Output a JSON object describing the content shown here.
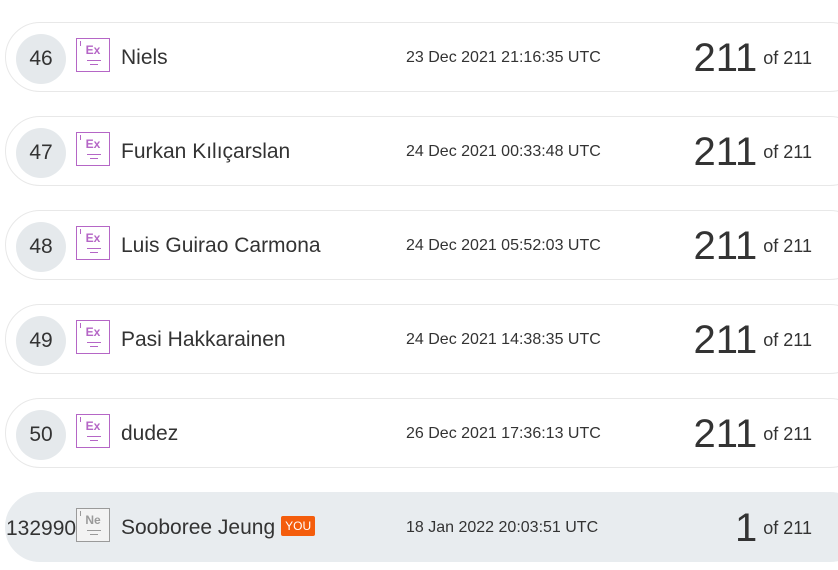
{
  "leaderboard": {
    "of_label": "of",
    "total": "211",
    "you_label": "YOU",
    "colors": {
      "expert_badge": "#b566c6",
      "newbie_badge": "#9a9a9a",
      "you_tag": "#f45d0c",
      "highlight_row": "#e8ecef"
    },
    "rows": [
      {
        "rank": "46",
        "badge_icon": "expert-badge-icon",
        "badge_text": "Ex",
        "name": "Niels",
        "date": "23 Dec 2021 21:16:35 UTC",
        "score": "211"
      },
      {
        "rank": "47",
        "badge_icon": "expert-badge-icon",
        "badge_text": "Ex",
        "name": "Furkan Kılıçarslan",
        "date": "24 Dec 2021 00:33:48 UTC",
        "score": "211"
      },
      {
        "rank": "48",
        "badge_icon": "expert-badge-icon",
        "badge_text": "Ex",
        "name": "Luis Guirao Carmona",
        "date": "24 Dec 2021 05:52:03 UTC",
        "score": "211"
      },
      {
        "rank": "49",
        "badge_icon": "expert-badge-icon",
        "badge_text": "Ex",
        "name": "Pasi Hakkarainen",
        "date": "24 Dec 2021 14:38:35 UTC",
        "score": "211"
      },
      {
        "rank": "50",
        "badge_icon": "expert-badge-icon",
        "badge_text": "Ex",
        "name": "dudez",
        "date": "26 Dec 2021 17:36:13 UTC",
        "score": "211"
      }
    ],
    "current_user": {
      "rank": "132990",
      "badge_icon": "newbie-badge-icon",
      "badge_text": "Ne",
      "name": "Sooboree Jeung",
      "date": "18 Jan 2022 20:03:51 UTC",
      "score": "1"
    }
  }
}
